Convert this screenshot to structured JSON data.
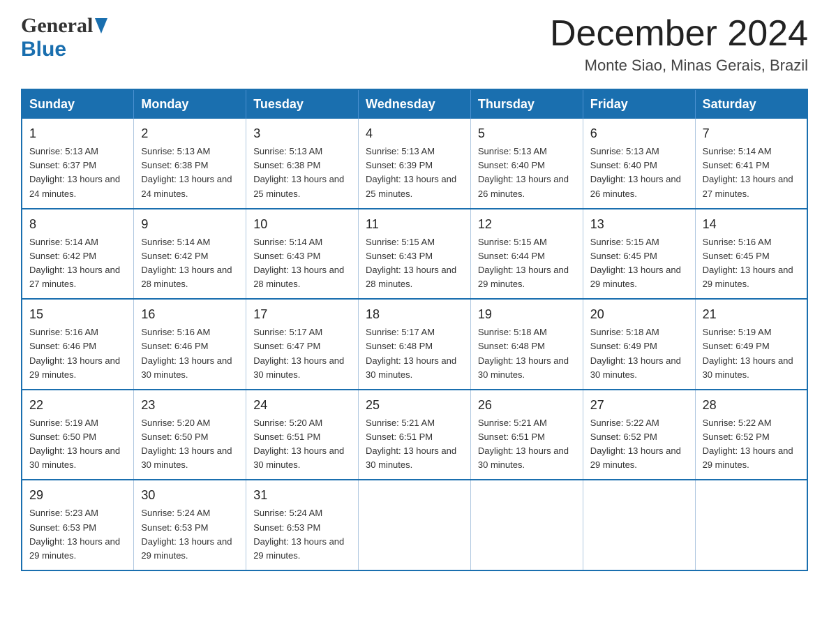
{
  "header": {
    "logo_general": "General",
    "logo_blue": "Blue",
    "month_title": "December 2024",
    "location": "Monte Siao, Minas Gerais, Brazil"
  },
  "weekdays": [
    "Sunday",
    "Monday",
    "Tuesday",
    "Wednesday",
    "Thursday",
    "Friday",
    "Saturday"
  ],
  "weeks": [
    [
      {
        "day": "1",
        "sunrise": "Sunrise: 5:13 AM",
        "sunset": "Sunset: 6:37 PM",
        "daylight": "Daylight: 13 hours and 24 minutes."
      },
      {
        "day": "2",
        "sunrise": "Sunrise: 5:13 AM",
        "sunset": "Sunset: 6:38 PM",
        "daylight": "Daylight: 13 hours and 24 minutes."
      },
      {
        "day": "3",
        "sunrise": "Sunrise: 5:13 AM",
        "sunset": "Sunset: 6:38 PM",
        "daylight": "Daylight: 13 hours and 25 minutes."
      },
      {
        "day": "4",
        "sunrise": "Sunrise: 5:13 AM",
        "sunset": "Sunset: 6:39 PM",
        "daylight": "Daylight: 13 hours and 25 minutes."
      },
      {
        "day": "5",
        "sunrise": "Sunrise: 5:13 AM",
        "sunset": "Sunset: 6:40 PM",
        "daylight": "Daylight: 13 hours and 26 minutes."
      },
      {
        "day": "6",
        "sunrise": "Sunrise: 5:13 AM",
        "sunset": "Sunset: 6:40 PM",
        "daylight": "Daylight: 13 hours and 26 minutes."
      },
      {
        "day": "7",
        "sunrise": "Sunrise: 5:14 AM",
        "sunset": "Sunset: 6:41 PM",
        "daylight": "Daylight: 13 hours and 27 minutes."
      }
    ],
    [
      {
        "day": "8",
        "sunrise": "Sunrise: 5:14 AM",
        "sunset": "Sunset: 6:42 PM",
        "daylight": "Daylight: 13 hours and 27 minutes."
      },
      {
        "day": "9",
        "sunrise": "Sunrise: 5:14 AM",
        "sunset": "Sunset: 6:42 PM",
        "daylight": "Daylight: 13 hours and 28 minutes."
      },
      {
        "day": "10",
        "sunrise": "Sunrise: 5:14 AM",
        "sunset": "Sunset: 6:43 PM",
        "daylight": "Daylight: 13 hours and 28 minutes."
      },
      {
        "day": "11",
        "sunrise": "Sunrise: 5:15 AM",
        "sunset": "Sunset: 6:43 PM",
        "daylight": "Daylight: 13 hours and 28 minutes."
      },
      {
        "day": "12",
        "sunrise": "Sunrise: 5:15 AM",
        "sunset": "Sunset: 6:44 PM",
        "daylight": "Daylight: 13 hours and 29 minutes."
      },
      {
        "day": "13",
        "sunrise": "Sunrise: 5:15 AM",
        "sunset": "Sunset: 6:45 PM",
        "daylight": "Daylight: 13 hours and 29 minutes."
      },
      {
        "day": "14",
        "sunrise": "Sunrise: 5:16 AM",
        "sunset": "Sunset: 6:45 PM",
        "daylight": "Daylight: 13 hours and 29 minutes."
      }
    ],
    [
      {
        "day": "15",
        "sunrise": "Sunrise: 5:16 AM",
        "sunset": "Sunset: 6:46 PM",
        "daylight": "Daylight: 13 hours and 29 minutes."
      },
      {
        "day": "16",
        "sunrise": "Sunrise: 5:16 AM",
        "sunset": "Sunset: 6:46 PM",
        "daylight": "Daylight: 13 hours and 30 minutes."
      },
      {
        "day": "17",
        "sunrise": "Sunrise: 5:17 AM",
        "sunset": "Sunset: 6:47 PM",
        "daylight": "Daylight: 13 hours and 30 minutes."
      },
      {
        "day": "18",
        "sunrise": "Sunrise: 5:17 AM",
        "sunset": "Sunset: 6:48 PM",
        "daylight": "Daylight: 13 hours and 30 minutes."
      },
      {
        "day": "19",
        "sunrise": "Sunrise: 5:18 AM",
        "sunset": "Sunset: 6:48 PM",
        "daylight": "Daylight: 13 hours and 30 minutes."
      },
      {
        "day": "20",
        "sunrise": "Sunrise: 5:18 AM",
        "sunset": "Sunset: 6:49 PM",
        "daylight": "Daylight: 13 hours and 30 minutes."
      },
      {
        "day": "21",
        "sunrise": "Sunrise: 5:19 AM",
        "sunset": "Sunset: 6:49 PM",
        "daylight": "Daylight: 13 hours and 30 minutes."
      }
    ],
    [
      {
        "day": "22",
        "sunrise": "Sunrise: 5:19 AM",
        "sunset": "Sunset: 6:50 PM",
        "daylight": "Daylight: 13 hours and 30 minutes."
      },
      {
        "day": "23",
        "sunrise": "Sunrise: 5:20 AM",
        "sunset": "Sunset: 6:50 PM",
        "daylight": "Daylight: 13 hours and 30 minutes."
      },
      {
        "day": "24",
        "sunrise": "Sunrise: 5:20 AM",
        "sunset": "Sunset: 6:51 PM",
        "daylight": "Daylight: 13 hours and 30 minutes."
      },
      {
        "day": "25",
        "sunrise": "Sunrise: 5:21 AM",
        "sunset": "Sunset: 6:51 PM",
        "daylight": "Daylight: 13 hours and 30 minutes."
      },
      {
        "day": "26",
        "sunrise": "Sunrise: 5:21 AM",
        "sunset": "Sunset: 6:51 PM",
        "daylight": "Daylight: 13 hours and 30 minutes."
      },
      {
        "day": "27",
        "sunrise": "Sunrise: 5:22 AM",
        "sunset": "Sunset: 6:52 PM",
        "daylight": "Daylight: 13 hours and 29 minutes."
      },
      {
        "day": "28",
        "sunrise": "Sunrise: 5:22 AM",
        "sunset": "Sunset: 6:52 PM",
        "daylight": "Daylight: 13 hours and 29 minutes."
      }
    ],
    [
      {
        "day": "29",
        "sunrise": "Sunrise: 5:23 AM",
        "sunset": "Sunset: 6:53 PM",
        "daylight": "Daylight: 13 hours and 29 minutes."
      },
      {
        "day": "30",
        "sunrise": "Sunrise: 5:24 AM",
        "sunset": "Sunset: 6:53 PM",
        "daylight": "Daylight: 13 hours and 29 minutes."
      },
      {
        "day": "31",
        "sunrise": "Sunrise: 5:24 AM",
        "sunset": "Sunset: 6:53 PM",
        "daylight": "Daylight: 13 hours and 29 minutes."
      },
      null,
      null,
      null,
      null
    ]
  ]
}
